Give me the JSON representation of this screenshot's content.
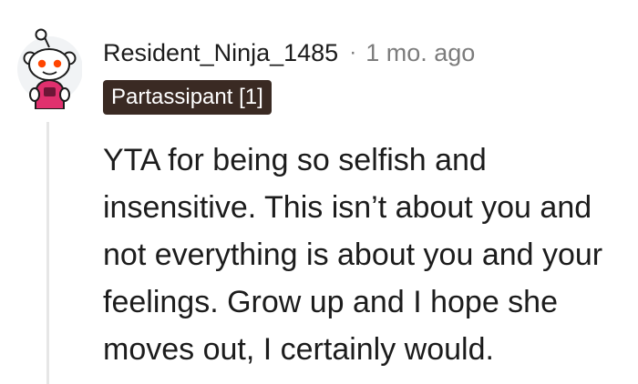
{
  "comment": {
    "author": "Resident_Ninja_1485",
    "separator": "·",
    "timestamp": "1 mo. ago",
    "flair": "Partassipant [1]",
    "avatar_icon": "snoo-avatar-icon",
    "body": "YTA for being so selfish and insensitive. This isn’t about you and not everything is about you and your feelings. Grow up and I hope she moves out, I certainly would."
  },
  "colors": {
    "text": "#1c1c1c",
    "meta_text": "#7c7c7c",
    "flair_bg": "#3a2a23",
    "thread_line": "#e6e6e6"
  }
}
